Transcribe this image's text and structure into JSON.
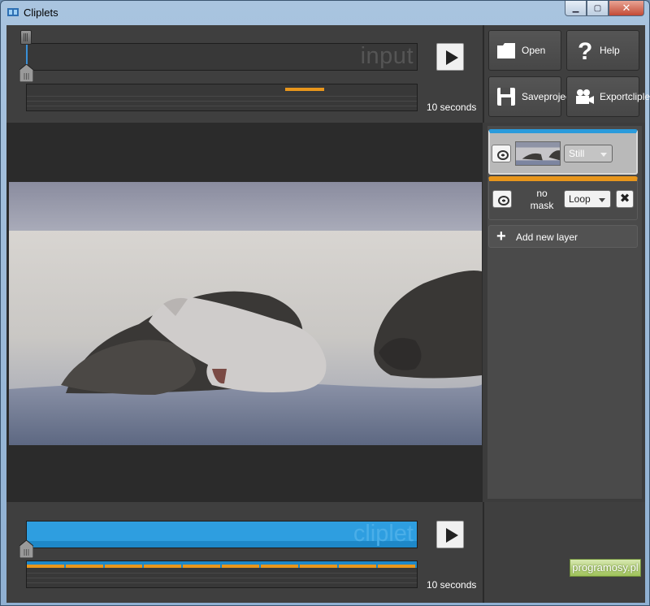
{
  "window": {
    "title": "Cliplets"
  },
  "input": {
    "track_label": "input",
    "duration": "10 seconds"
  },
  "toolbar": {
    "open": "Open",
    "help": "Help",
    "save_line1": "Save",
    "save_line2": "project",
    "export_line1": "Export",
    "export_line2": "cliplet"
  },
  "layers": {
    "layer1_mode": "Still",
    "layer2_mask_line1": "no",
    "layer2_mask_line2": "mask",
    "layer2_mode": "Loop",
    "add_layer": "Add new layer"
  },
  "cliplet": {
    "track_label": "cliplet",
    "duration": "10 seconds"
  },
  "watermark": "programosy.pl",
  "colors": {
    "accent_blue": "#2e9ee0",
    "accent_orange": "#e8961c",
    "panel": "#3f3f3f"
  }
}
